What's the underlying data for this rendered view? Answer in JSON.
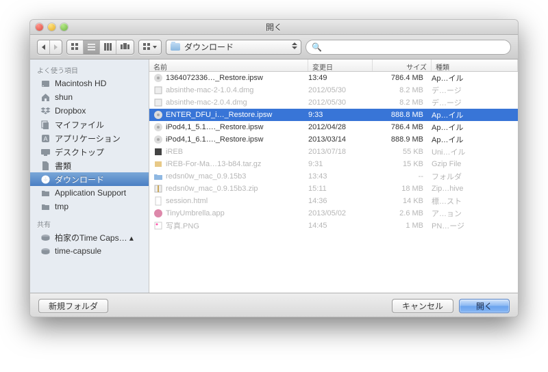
{
  "window": {
    "title": "開く"
  },
  "toolbar": {
    "location_label": "ダウンロード",
    "search_placeholder": ""
  },
  "sidebar": {
    "favorites_header": "よく使う項目",
    "shared_header": "共有",
    "favorites": [
      {
        "label": "Macintosh HD",
        "icon": "drive"
      },
      {
        "label": "shun",
        "icon": "home"
      },
      {
        "label": "Dropbox",
        "icon": "dropbox"
      },
      {
        "label": "マイファイル",
        "icon": "allfiles"
      },
      {
        "label": "アプリケーション",
        "icon": "apps"
      },
      {
        "label": "デスクトップ",
        "icon": "desktop"
      },
      {
        "label": "書類",
        "icon": "docs"
      },
      {
        "label": "ダウンロード",
        "icon": "downloads",
        "selected": true
      },
      {
        "label": "Application Support",
        "icon": "folder"
      },
      {
        "label": "tmp",
        "icon": "folder"
      }
    ],
    "shared": [
      {
        "label": "柏家のTime Caps… ▴",
        "icon": "timecapsule"
      },
      {
        "label": "time-capsule",
        "icon": "timecapsule"
      }
    ]
  },
  "columns": {
    "name": "名前",
    "modified": "変更日",
    "size": "サイズ",
    "kind": "種類"
  },
  "files": [
    {
      "name": "1364072336…_Restore.ipsw",
      "mod": "13:49",
      "size": "786.4 MB",
      "kind": "Ap…イル",
      "icon": "ipsw",
      "dim": false
    },
    {
      "name": "absinthe-mac-2-1.0.4.dmg",
      "mod": "2012/05/30",
      "size": "8.2 MB",
      "kind": "デ…ージ",
      "icon": "dmg",
      "dim": true
    },
    {
      "name": "absinthe-mac-2.0.4.dmg",
      "mod": "2012/05/30",
      "size": "8.2 MB",
      "kind": "デ…ージ",
      "icon": "dmg",
      "dim": true
    },
    {
      "name": "ENTER_DFU_i…_Restore.ipsw",
      "mod": "9:33",
      "size": "888.8 MB",
      "kind": "Ap…イル",
      "icon": "ipsw",
      "dim": false,
      "selected": true
    },
    {
      "name": "iPod4,1_5.1…._Restore.ipsw",
      "mod": "2012/04/28",
      "size": "786.4 MB",
      "kind": "Ap…イル",
      "icon": "ipsw",
      "dim": false
    },
    {
      "name": "iPod4,1_6.1…._Restore.ipsw",
      "mod": "2013/03/14",
      "size": "888.9 MB",
      "kind": "Ap…イル",
      "icon": "ipsw",
      "dim": false
    },
    {
      "name": "iREB",
      "mod": "2013/07/18",
      "size": "55 KB",
      "kind": "Uni…イル",
      "icon": "exec",
      "dim": true
    },
    {
      "name": "iREB-For-Ma…13-b84.tar.gz",
      "mod": "9:31",
      "size": "15 KB",
      "kind": "Gzip File",
      "icon": "gz",
      "dim": true
    },
    {
      "name": "redsn0w_mac_0.9.15b3",
      "mod": "13:43",
      "size": "--",
      "kind": "フォルダ",
      "icon": "folder",
      "dim": true
    },
    {
      "name": "redsn0w_mac_0.9.15b3.zip",
      "mod": "15:11",
      "size": "18 MB",
      "kind": "Zip…hive",
      "icon": "zip",
      "dim": true
    },
    {
      "name": "session.html",
      "mod": "14:36",
      "size": "14 KB",
      "kind": "標…スト",
      "icon": "html",
      "dim": true
    },
    {
      "name": "TinyUmbrella.app",
      "mod": "2013/05/02",
      "size": "2.6 MB",
      "kind": "ア…ョン",
      "icon": "app",
      "dim": true
    },
    {
      "name": "写真.PNG",
      "mod": "14:45",
      "size": "1 MB",
      "kind": "PN…ージ",
      "icon": "png",
      "dim": true
    }
  ],
  "buttons": {
    "new_folder": "新規フォルダ",
    "cancel": "キャンセル",
    "open": "開く"
  }
}
